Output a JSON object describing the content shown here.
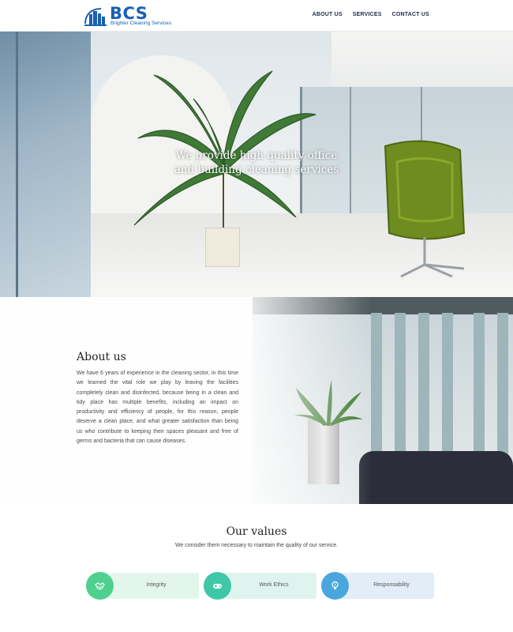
{
  "header": {
    "logo_text": "BCS",
    "logo_subtitle": "Brighter Cleaning Services",
    "nav": [
      "ABOUT US",
      "SERVICES",
      "CONTACT US"
    ]
  },
  "hero": {
    "title_line1": "We provide high quality office",
    "title_line2": "and building cleaning services"
  },
  "about": {
    "title": "About us",
    "body": "We have 6 years of experience in the cleaning sector, in this time we learned the vital role we play by leaving the facilities completely clean and disinfected, because being in a clean and tidy place has multiple benefits, including an impact on productivity and efficiency of people, for this reason, people deserve a clean place, and what greater satisfaction than being us who contribute to keeping their spaces pleasant and free of germs and bacteria that can cause diseases."
  },
  "values": {
    "title": "Our values",
    "subtitle": "We consider them necessary to maintain the quality of our service.",
    "items": [
      {
        "label": "Integrity",
        "icon": "handshake-icon",
        "color": "#4fd08e"
      },
      {
        "label": "Work Ethics",
        "icon": "gamepad-icon",
        "color": "#3fc8a8"
      },
      {
        "label": "Responsability",
        "icon": "lightbulb-icon",
        "color": "#4aa7de"
      }
    ]
  },
  "colors": {
    "brand": "#1a5fb4",
    "nav_text": "#1f2a44"
  }
}
